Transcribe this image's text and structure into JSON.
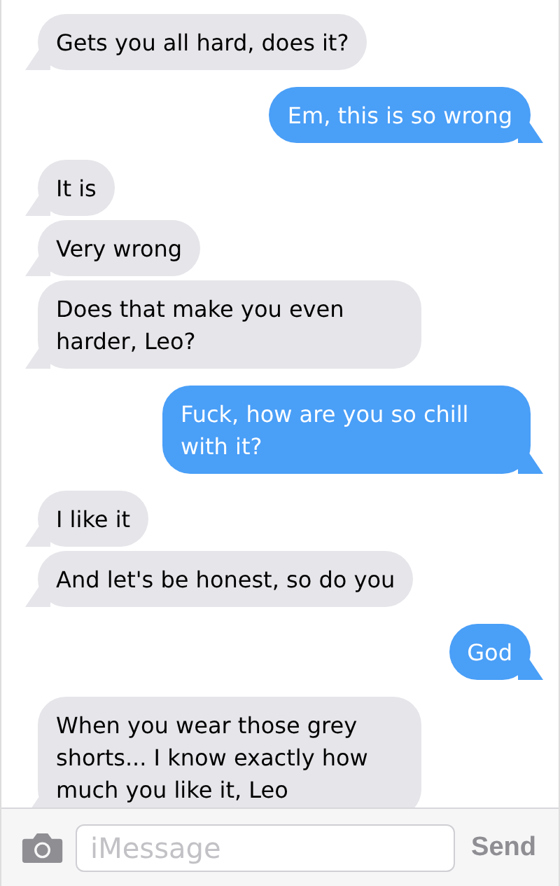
{
  "messages": [
    {
      "text": "Gets you all hard, does it?",
      "kind": "received"
    },
    {
      "text": "Em, this is so wrong",
      "kind": "sent"
    },
    {
      "text": "It is",
      "kind": "received"
    },
    {
      "text": "Very wrong",
      "kind": "received"
    },
    {
      "text": "Does that make you even harder, Leo?",
      "kind": "received"
    },
    {
      "text": "Fuck, how are you so chill with it?",
      "kind": "sent"
    },
    {
      "text": "I like it",
      "kind": "received"
    },
    {
      "text": "And let's be honest, so do you",
      "kind": "received"
    },
    {
      "text": "God",
      "kind": "sent"
    },
    {
      "text": "When you wear those grey shorts... I know exactly how much you like it, Leo",
      "kind": "received"
    }
  ],
  "composer": {
    "placeholder": "iMessage",
    "send": "Send"
  }
}
